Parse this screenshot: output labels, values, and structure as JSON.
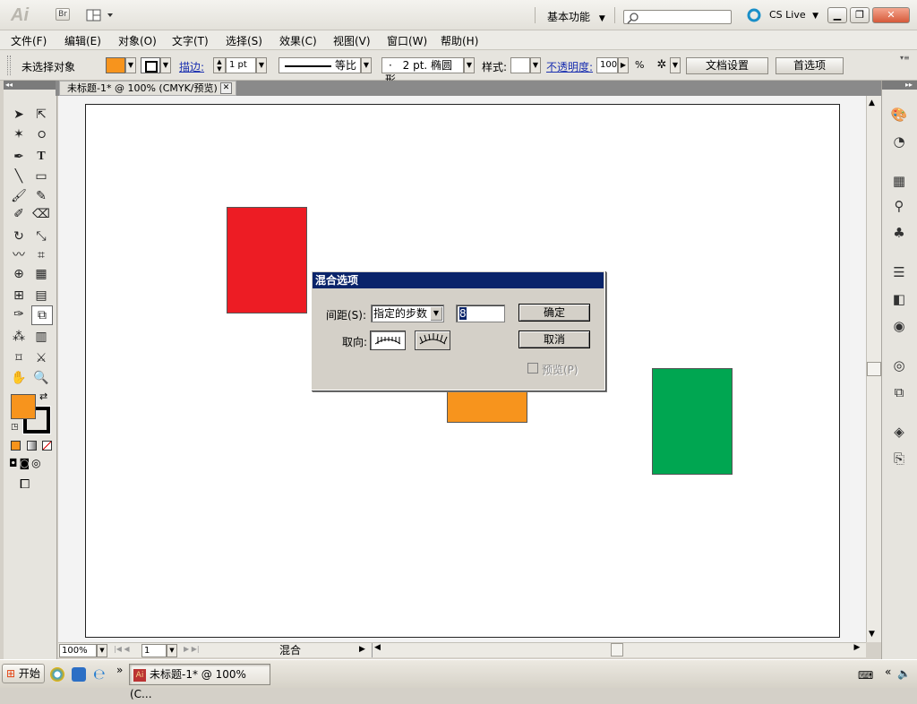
{
  "app": {
    "logo": "Ai",
    "bridge": "Br",
    "workspace": "基本功能",
    "cs_live": "CS Live"
  },
  "menu": [
    "文件(F)",
    "编辑(E)",
    "对象(O)",
    "文字(T)",
    "选择(S)",
    "效果(C)",
    "视图(V)",
    "窗口(W)",
    "帮助(H)"
  ],
  "control": {
    "selection": "未选择对象",
    "fill_color": "#f7941d",
    "stroke_label": "描边:",
    "stroke_weight": "1 pt",
    "stroke_profile": "等比",
    "brush": "2 pt. 椭圆形",
    "style_label": "样式:",
    "opacity_label": "不透明度:",
    "opacity": "100",
    "percent": "%",
    "doc_setup": "文档设置",
    "preferences": "首选项"
  },
  "document": {
    "tab": "未标题-1* @ 100% (CMYK/预览)"
  },
  "shapes": [
    {
      "name": "red-rectangle",
      "color": "#ed1c24"
    },
    {
      "name": "orange-rectangle",
      "color": "#f7941d"
    },
    {
      "name": "green-rectangle",
      "color": "#00a651"
    }
  ],
  "dialog": {
    "title": "混合选项",
    "spacing_label": "间距(S):",
    "spacing_value": "指定的步数",
    "steps": "8",
    "orientation_label": "取向:",
    "ok": "确定",
    "cancel": "取消",
    "preview": "预览(P)",
    "preview_checked": false
  },
  "status": {
    "zoom": "100%",
    "page": "1",
    "tool": "混合"
  },
  "taskbar": {
    "start": "开始",
    "task": "未标题-1* @ 100% (C..."
  }
}
